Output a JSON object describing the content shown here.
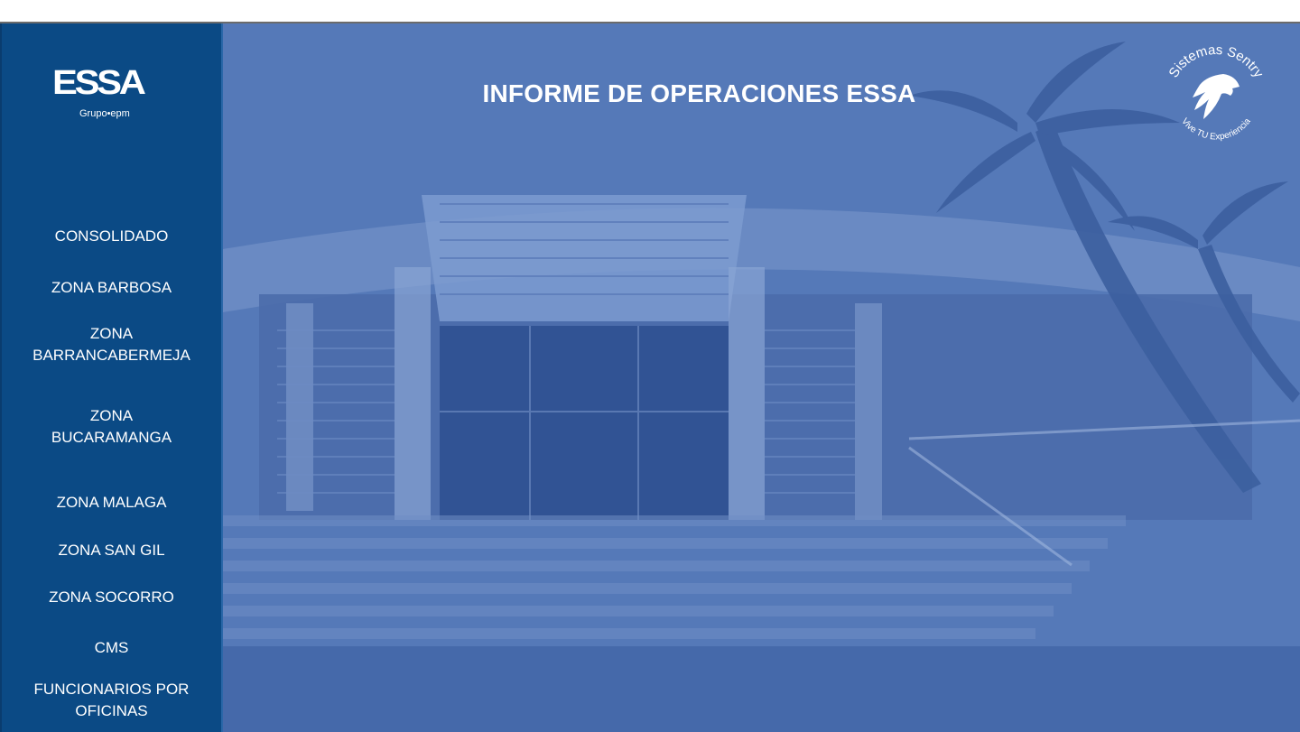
{
  "header": {
    "title": "INFORME DE OPERACIONES ESSA"
  },
  "brand": {
    "wordmark": "ESSA",
    "subtitle": "Grupo•epm"
  },
  "badge": {
    "top_text": "Sistemas Sentry",
    "bottom_text": "Vive TU Experiencia"
  },
  "sidebar": {
    "items": [
      {
        "label": "CONSOLIDADO"
      },
      {
        "label": "ZONA BARBOSA"
      },
      {
        "label": "ZONA\nBARRANCABERMEJA"
      },
      {
        "label": "ZONA\nBUCARAMANGA"
      },
      {
        "label": "ZONA MALAGA"
      },
      {
        "label": "ZONA SAN GIL"
      },
      {
        "label": "ZONA SOCORRO"
      },
      {
        "label": "CMS"
      },
      {
        "label": "FUNCIONARIOS POR\nOFICINAS"
      }
    ]
  },
  "colors": {
    "sidebar": "#0b4a85",
    "overlay": "#4a6fb0",
    "text": "#ffffff"
  }
}
